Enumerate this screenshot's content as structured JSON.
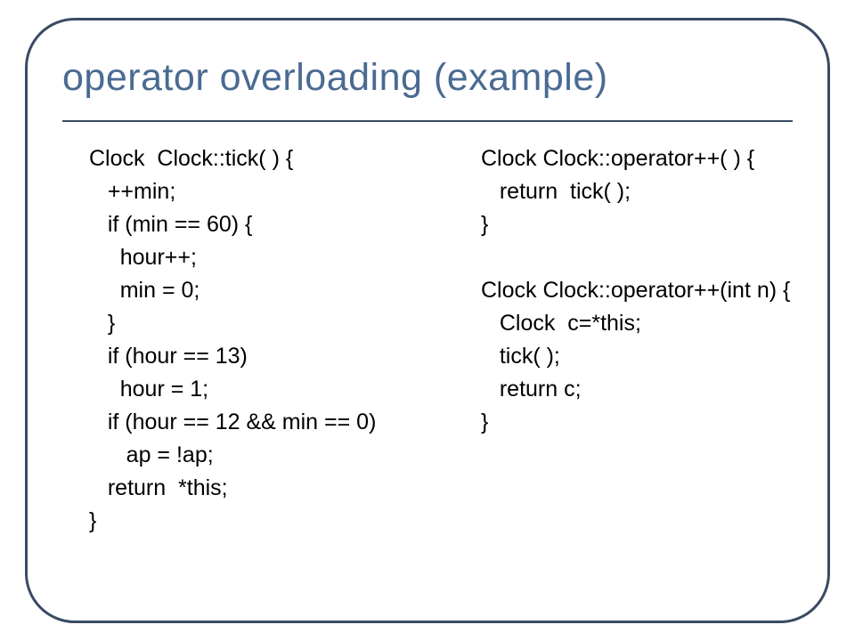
{
  "title": "operator overloading (example)",
  "left": {
    "l0": "Clock  Clock::tick( ) {",
    "l1": "   ++min;",
    "l2": "   if (min == 60) {",
    "l3": "     hour++;",
    "l4": "     min = 0;",
    "l5": "   }",
    "l6": "   if (hour == 13)",
    "l7": "     hour = 1;",
    "l8": "   if (hour == 12 && min == 0)",
    "l9": "      ap = !ap;",
    "l10": "   return  *this;",
    "l11": "}"
  },
  "right": {
    "l0": "Clock Clock::operator++( ) {",
    "l1": "   return  tick( );",
    "l2": "}",
    "l3": "Clock Clock::operator++(int n) {",
    "l4": "   Clock  c=*this;",
    "l5": "   tick( );",
    "l6": "   return c;",
    "l7": "}"
  }
}
